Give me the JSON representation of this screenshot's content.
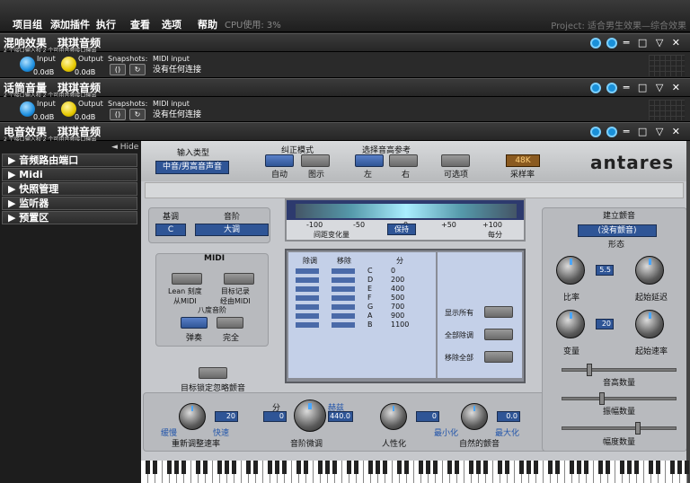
{
  "menubar": {
    "items": [
      "项目组",
      "添加插件",
      "执行",
      "查看",
      "选项",
      "帮助"
    ],
    "cpu": "CPU使用: 3%",
    "project": "Project: 适合男生效果—综合效果"
  },
  "strips": [
    {
      "name": "混响效果　琪琪音频",
      "sub": "2 个接口输入和 2 个可用音频接口输出",
      "input": "Input",
      "output": "Output",
      "input_db": "0.0dB",
      "output_db": "0.0dB",
      "snapshots": "Snapshots:",
      "midi_label": "MIDI input",
      "midi_value": "没有任何连接",
      "expanded": true
    },
    {
      "name": "话筒音量　琪琪音频",
      "sub": "2 个接口输入和 2 个可用音频接口输出",
      "input": "Input",
      "output": "Output",
      "input_db": "0.0dB",
      "output_db": "0.0dB",
      "snapshots": "Snapshots:",
      "midi_label": "MIDI input",
      "midi_value": "没有任何连接",
      "expanded": true
    },
    {
      "name": "电音效果　琪琪音频",
      "sub": "2 个接口输入和 2 个可用音频接口输出",
      "expanded": false
    }
  ],
  "sidebar": {
    "hide": "◄ Hide",
    "items": [
      "▶ 音频路由端口",
      "▶ Midi",
      "▶ 快照管理",
      "▶ 监听器",
      "▶ 预置区"
    ]
  },
  "plugin": {
    "brand": "antares",
    "input_type_label": "输入类型",
    "input_type_value": "中音/男高音声音",
    "correction_mode_label": "纠正模式",
    "auto": "自动",
    "graph": "图示",
    "pitch_ref_label": "选择音高参考",
    "left": "左",
    "right": "右",
    "optional": "可选项",
    "sample_rate_value": "48K",
    "sample_rate_label": "采样率",
    "key_label": "基调",
    "scale_label": "音阶",
    "key_value": "C",
    "scale_value": "大调",
    "meter_ticks": [
      "-100",
      "-50",
      "0",
      "+50",
      "+100"
    ],
    "meter_left": "间距变化量",
    "meter_hold": "保持",
    "meter_right": "每分",
    "scale_table_headers": [
      "除调",
      "移除",
      "分"
    ],
    "notes": [
      "C",
      "D",
      "E",
      "F",
      "G",
      "A",
      "B"
    ],
    "cents": [
      "0",
      "200",
      "400",
      "500",
      "700",
      "900",
      "1100"
    ],
    "show_all": "显示所有",
    "all_bypass": "全部除调",
    "remove_all": "移除全部",
    "midi_title": "MIDI",
    "learn": "Lean 刻度\n从MIDI",
    "target": "目标记录\n经由MIDI",
    "octave_label": "八度音阶",
    "as_played": "弹奏",
    "all": "完全",
    "target_ignore": "目标锁定忽略颤音",
    "slow": "缓慢",
    "fast": "快速",
    "retune_label": "重新调整速率",
    "retune_value": "20",
    "detune_label": "音阶微调",
    "detune_cents_label": "分",
    "detune_cents_value": "0",
    "hertz_label": "赫兹",
    "hertz_value": "440.0",
    "humanize_label": "人性化",
    "humanize_value": "0",
    "natural_vibrato_label": "自然的颤音",
    "min": "最小化",
    "max": "最大化",
    "natural_value": "0.0",
    "create_vibrato": "建立颤音",
    "vibrato_shape_value": "(没有颤音)",
    "shape_label": "形态",
    "rate_label": "比率",
    "rate_value": "5.5",
    "onset_delay_label": "起始延迟",
    "variation_label": "变量",
    "variation_value": "20",
    "onset_rate_label": "起始速率",
    "pitch_amount_label": "音高数量",
    "amplitude_amount_label": "振幅数量",
    "formant_amount_label": "幅度数量"
  }
}
